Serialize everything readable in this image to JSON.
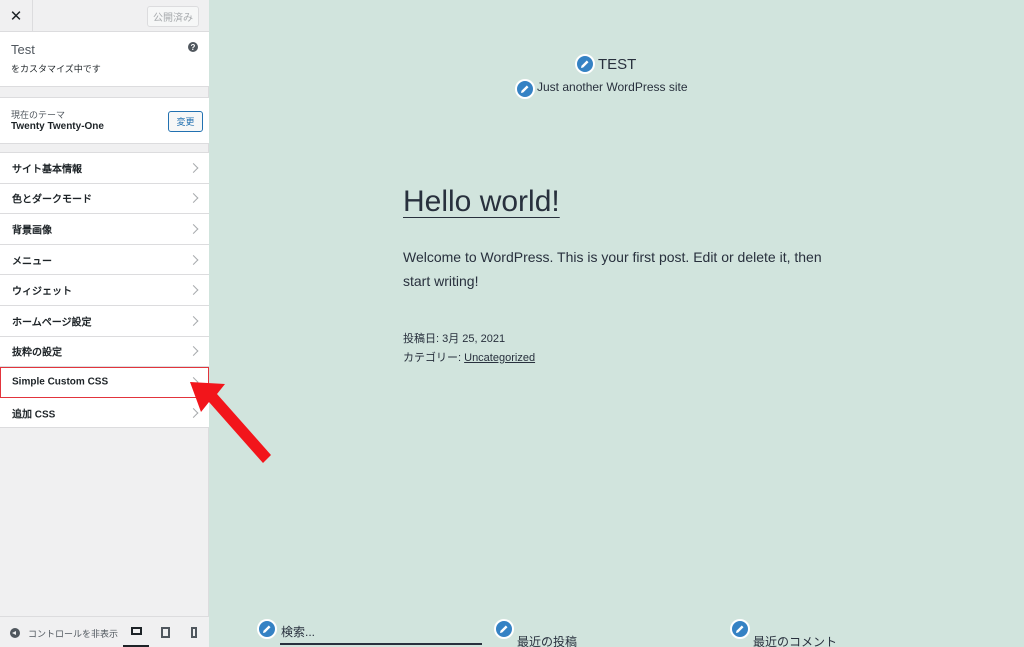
{
  "header": {
    "close_glyph": "✕",
    "publish_label": "公開済み"
  },
  "info": {
    "site_name": "Test",
    "subtitle": "をカスタマイズ中です",
    "help_glyph": "?"
  },
  "theme": {
    "label": "現在のテーマ",
    "name": "Twenty Twenty-One",
    "change_label": "変更"
  },
  "menu": {
    "items": [
      {
        "label": "サイト基本情報"
      },
      {
        "label": "色とダークモード"
      },
      {
        "label": "背景画像"
      },
      {
        "label": "メニュー"
      },
      {
        "label": "ウィジェット"
      },
      {
        "label": "ホームページ設定"
      },
      {
        "label": "抜粋の設定"
      },
      {
        "label": "Simple Custom CSS",
        "highlighted": true
      },
      {
        "label": "追加 CSS"
      }
    ]
  },
  "footer": {
    "collapse_label": "コントロールを非表示"
  },
  "preview": {
    "site_title": "TEST",
    "tagline": "Just another WordPress site",
    "post_title": "Hello world!",
    "excerpt": "Welcome to WordPress. This is your first post. Edit or delete it, then start writing!",
    "date_line": "投稿日: 3月 25, 2021",
    "category_prefix": "カテゴリー: ",
    "category_link": "Uncategorized",
    "widgets": {
      "search": "検索...",
      "recent_posts": "最近の投稿",
      "recent_comments": "最近のコメント"
    }
  },
  "colors": {
    "preview_bg": "#d1e4dd",
    "accent": "#2271b1",
    "edit_shortcut": "#3582c4",
    "highlight_border": "#e2343c",
    "arrow": "#f2151b"
  },
  "icons": {
    "close": "close-icon",
    "help": "help-icon",
    "chevron": "chevron-right-icon",
    "edit": "pencil-icon",
    "collapse": "collapse-arrow-icon",
    "desktop": "desktop-icon",
    "tablet": "tablet-icon",
    "mobile": "mobile-icon",
    "annotation": "red-arrow-icon"
  }
}
